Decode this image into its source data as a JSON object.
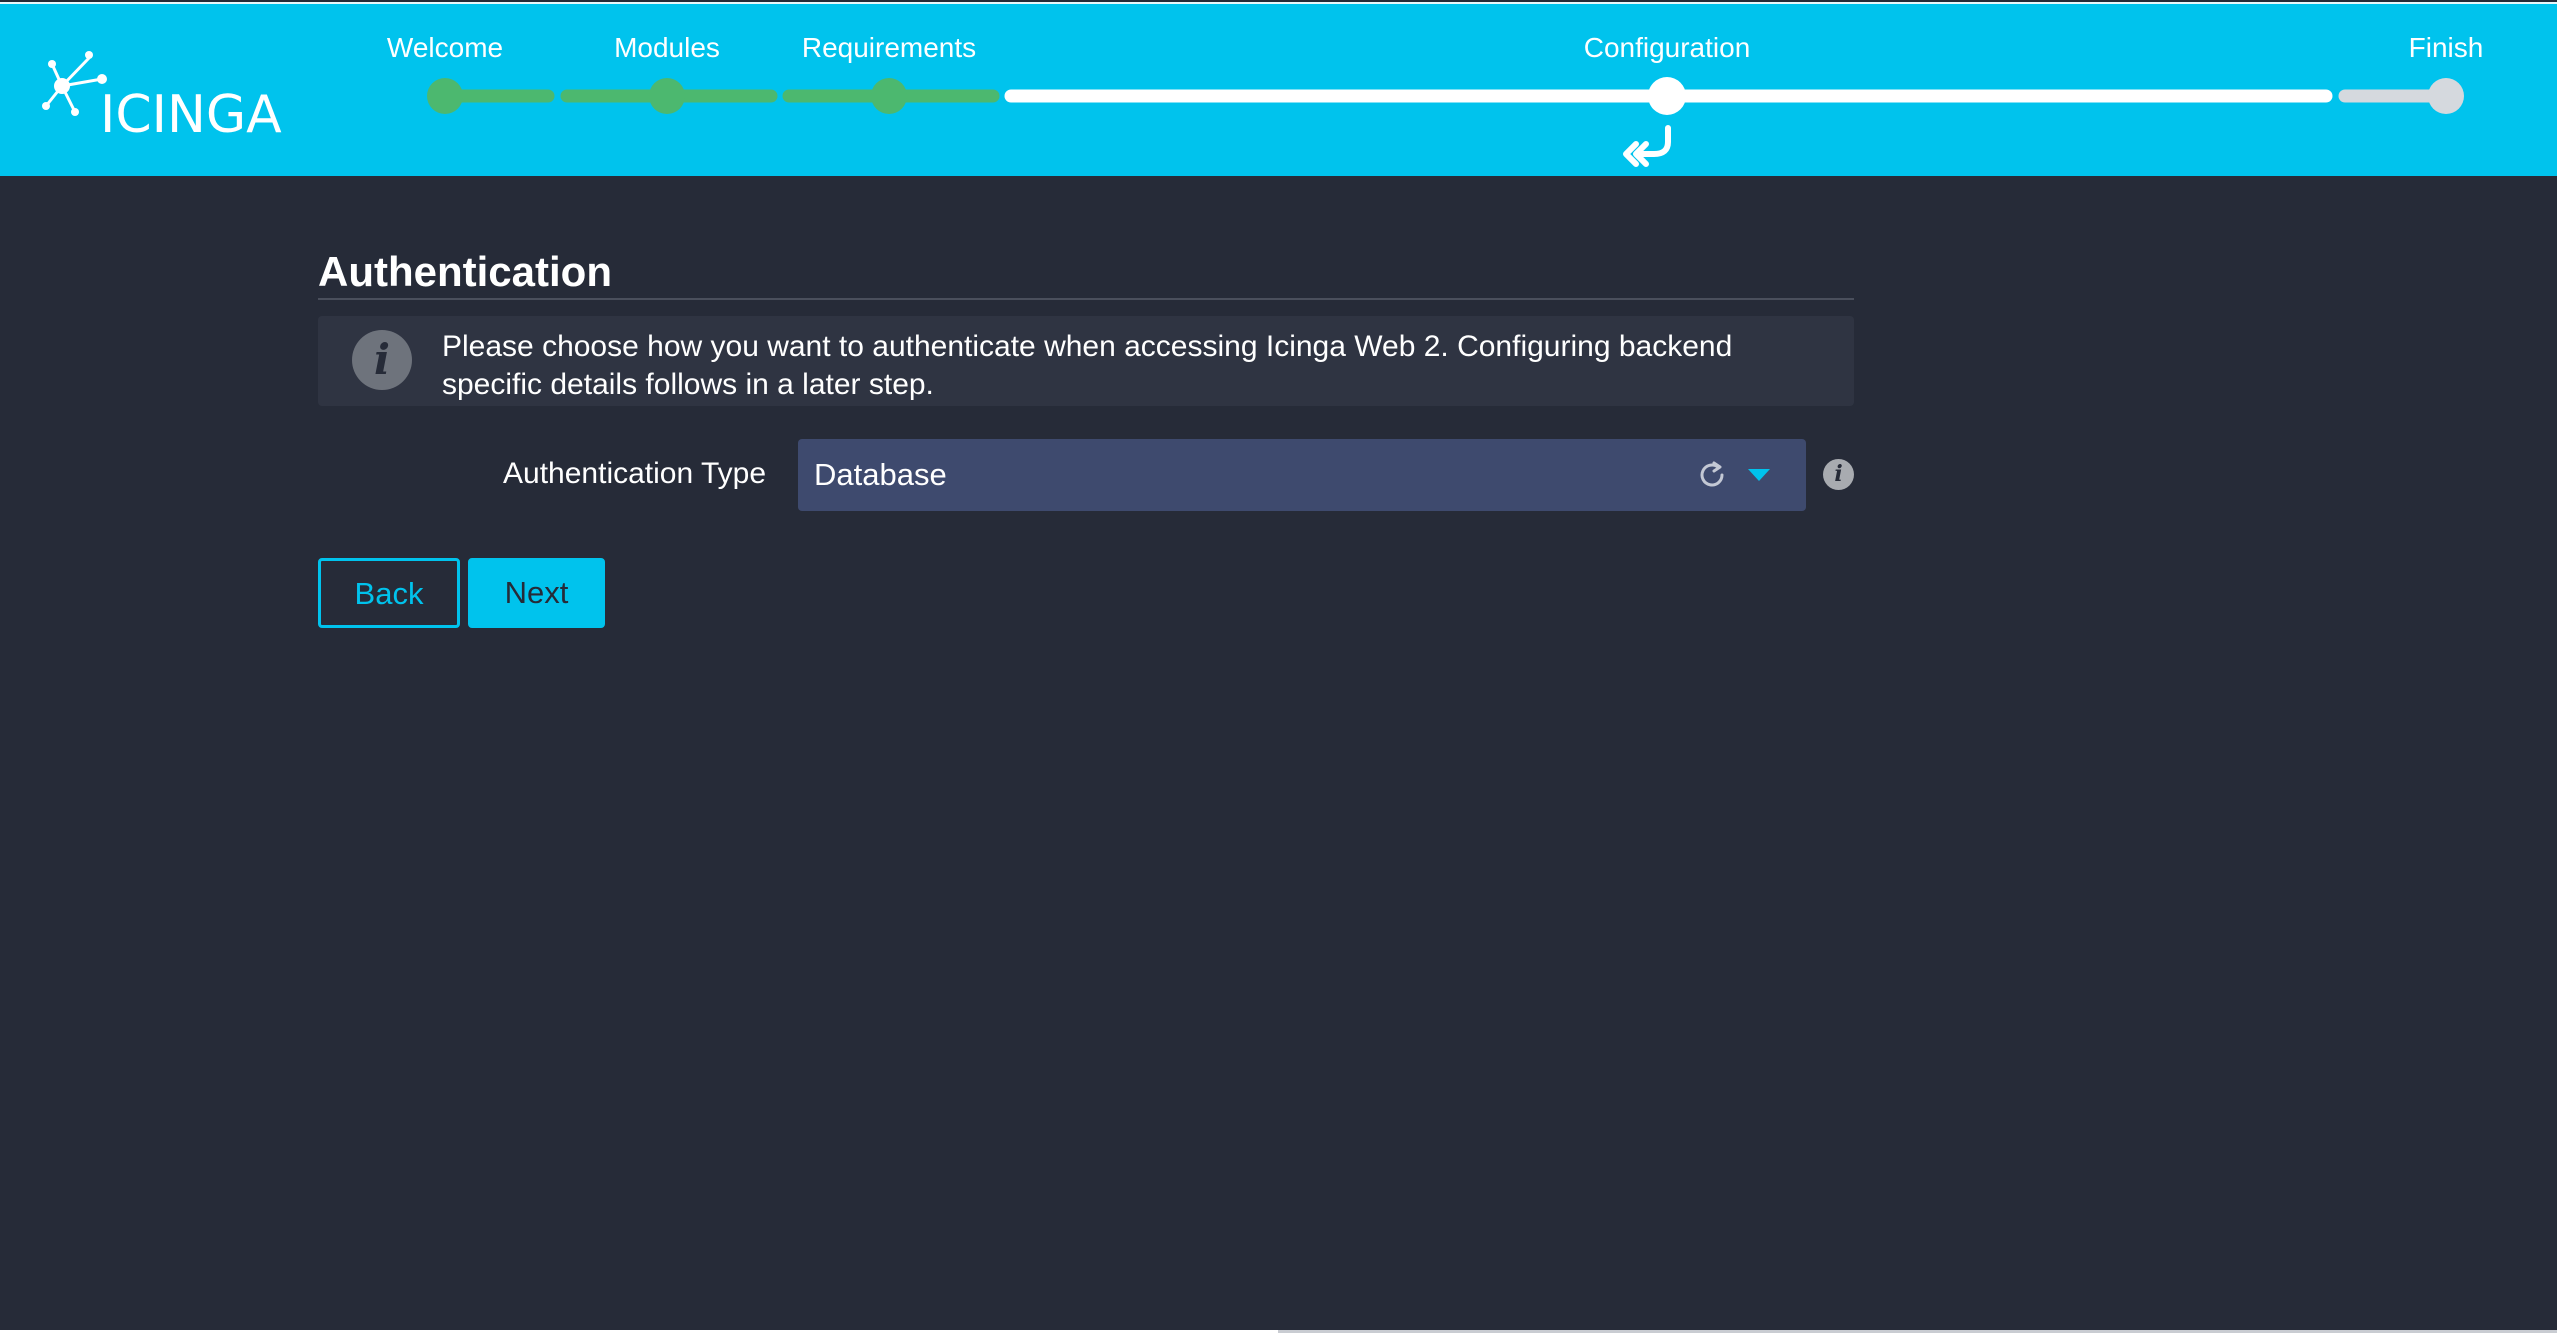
{
  "header": {
    "logo_text": "ICINGA",
    "steps": [
      {
        "label": "Welcome",
        "state": "complete"
      },
      {
        "label": "Modules",
        "state": "complete"
      },
      {
        "label": "Requirements",
        "state": "complete"
      },
      {
        "label": "Configuration",
        "state": "current"
      },
      {
        "label": "Finish",
        "state": "pending"
      }
    ],
    "colors": {
      "background": "#00c3ed",
      "complete": "#4cb86f",
      "current": "#ffffff",
      "pending": "#d5d9de"
    },
    "current_step_icon": "double-return-arrow-icon"
  },
  "main": {
    "section_title": "Authentication",
    "info_text": "Please choose how you want to authenticate when accessing Icinga Web 2. Configuring backend specific details follows in a later step.",
    "info_icon": "info-icon",
    "form": {
      "auth_type_label": "Authentication Type",
      "auth_type_value": "Database",
      "auth_type_icons": [
        "refresh-icon",
        "chevron-down-icon"
      ],
      "help_icon": "info-icon"
    },
    "buttons": {
      "back_label": "Back",
      "next_label": "Next"
    }
  },
  "theme": {
    "page_background": "#262b38",
    "accent": "#00c3ed",
    "select_background": "#3e4a6e"
  }
}
